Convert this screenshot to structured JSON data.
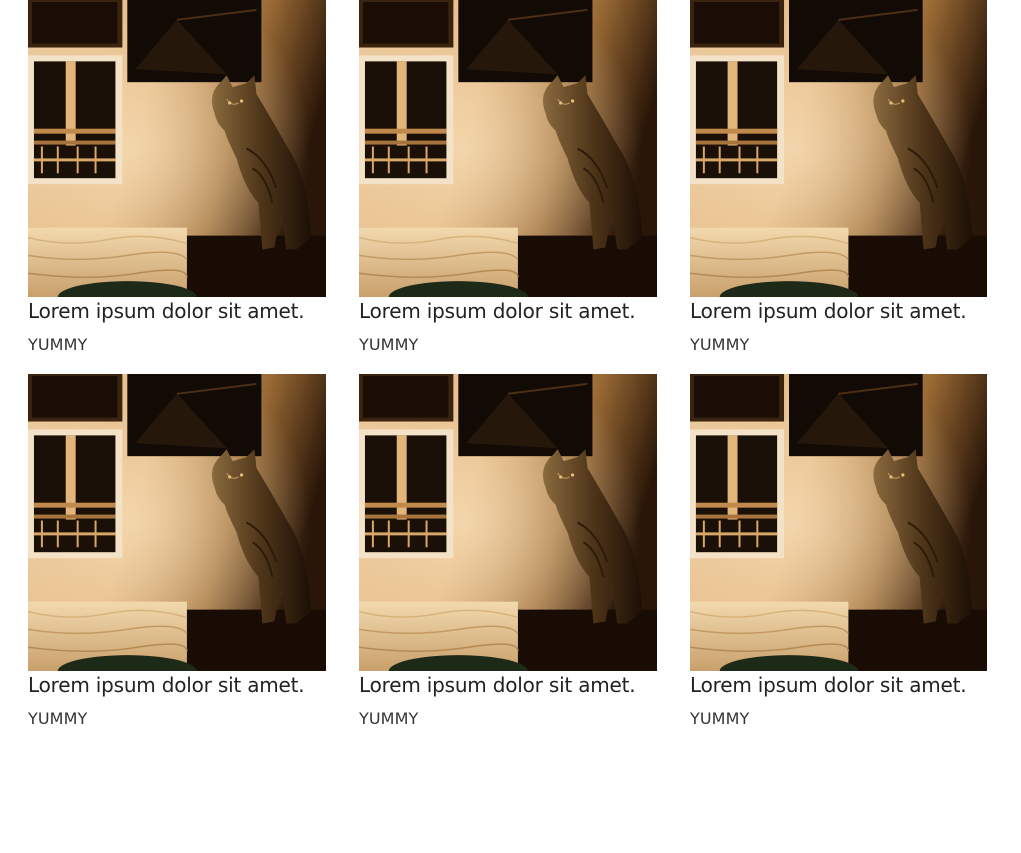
{
  "cards": [
    {
      "title": "Lorem ipsum dolor sit amet.",
      "tag": "YUMMY",
      "image_alt": "cat"
    },
    {
      "title": "Lorem ipsum dolor sit amet.",
      "tag": "YUMMY",
      "image_alt": "cat"
    },
    {
      "title": "Lorem ipsum dolor sit amet.",
      "tag": "YUMMY",
      "image_alt": "cat"
    },
    {
      "title": "Lorem ipsum dolor sit amet.",
      "tag": "YUMMY",
      "image_alt": "cat"
    },
    {
      "title": "Lorem ipsum dolor sit amet.",
      "tag": "YUMMY",
      "image_alt": "cat"
    },
    {
      "title": "Lorem ipsum dolor sit amet.",
      "tag": "YUMMY",
      "image_alt": "cat"
    }
  ]
}
